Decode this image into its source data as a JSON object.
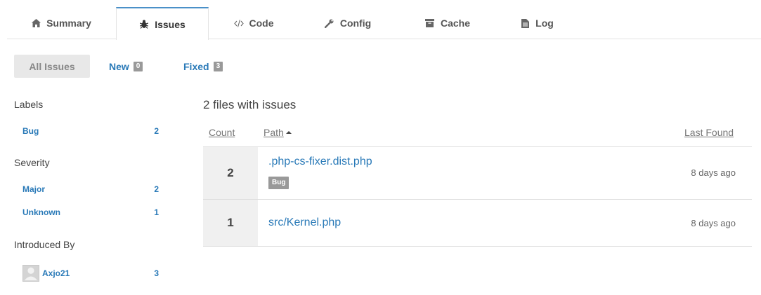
{
  "tabs": [
    {
      "label": "Summary",
      "icon": "home-icon"
    },
    {
      "label": "Issues",
      "icon": "bug-icon"
    },
    {
      "label": "Code",
      "icon": "code-icon"
    },
    {
      "label": "Config",
      "icon": "wrench-icon"
    },
    {
      "label": "Cache",
      "icon": "archive-icon"
    },
    {
      "label": "Log",
      "icon": "file-icon"
    }
  ],
  "filters": {
    "all_label": "All Issues",
    "new_label": "New",
    "new_count": "0",
    "fixed_label": "Fixed",
    "fixed_count": "3"
  },
  "sidebar": {
    "labels_heading": "Labels",
    "labels": [
      {
        "label": "Bug",
        "count": "2"
      }
    ],
    "severity_heading": "Severity",
    "severity": [
      {
        "label": "Major",
        "count": "2"
      },
      {
        "label": "Unknown",
        "count": "1"
      }
    ],
    "introduced_heading": "Introduced By",
    "introduced": [
      {
        "label": "Axjo21",
        "count": "3"
      }
    ]
  },
  "main": {
    "title": "2 files with issues",
    "columns": {
      "count": "Count",
      "path": "Path",
      "last_found": "Last Found"
    },
    "rows": [
      {
        "count": "2",
        "path": ".php-cs-fixer.dist.php",
        "label": "Bug",
        "last_found": "8 days ago"
      },
      {
        "count": "1",
        "path": "src/Kernel.php",
        "last_found": "8 days ago"
      }
    ]
  },
  "colors": {
    "accent": "#2a7ab8",
    "tab_active_border": "#4a90c8",
    "badge": "#999999"
  }
}
